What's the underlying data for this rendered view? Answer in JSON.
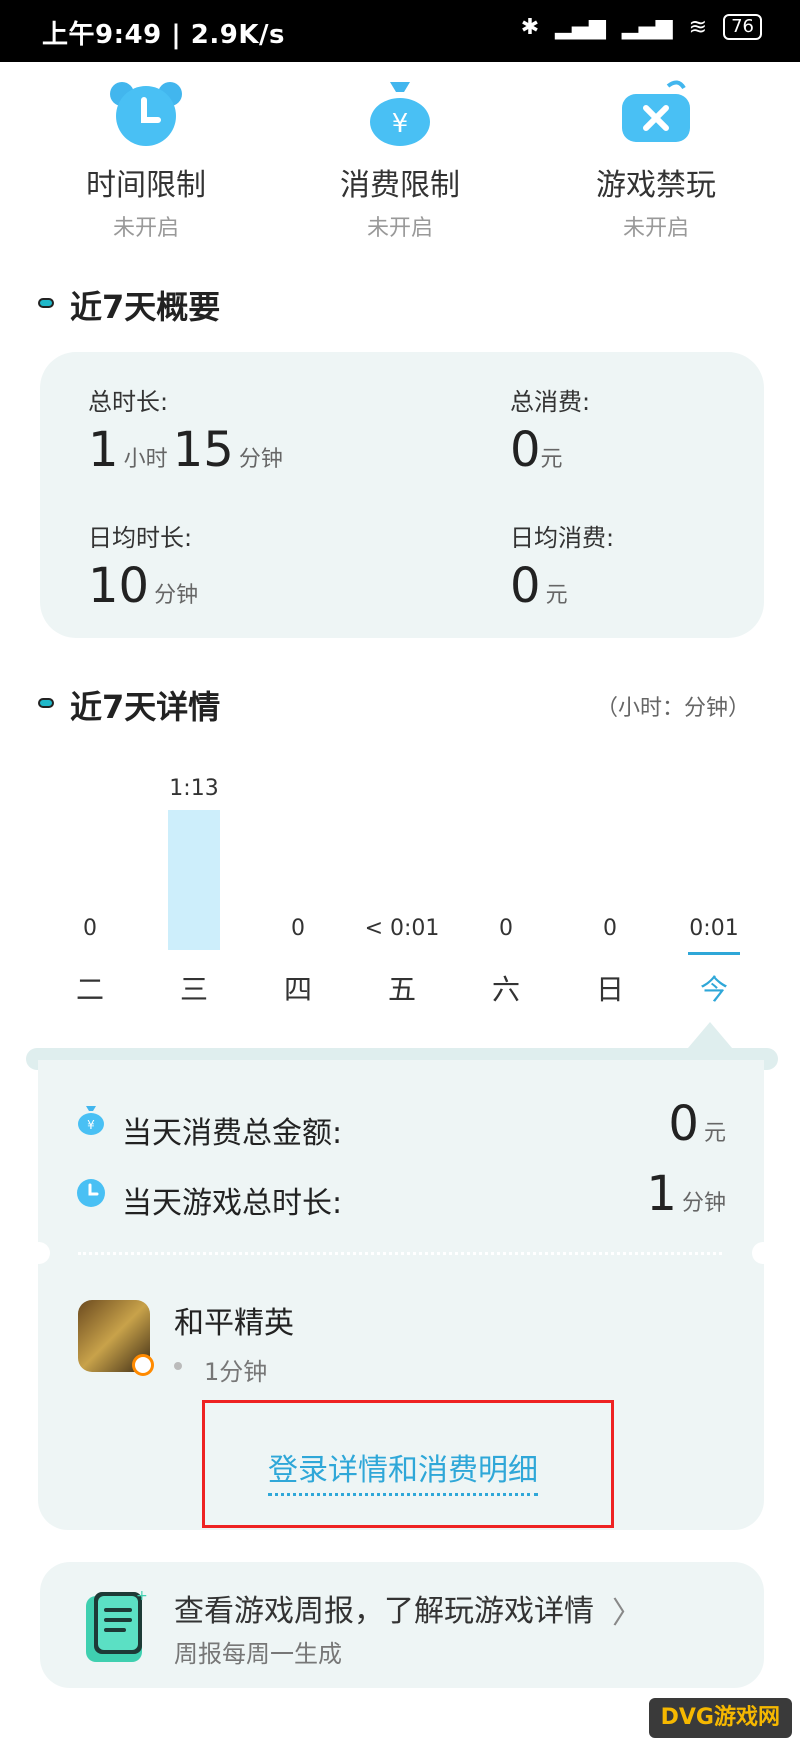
{
  "status_bar": {
    "time": "上午9:49 | 2.9K/s",
    "battery": "76"
  },
  "controls": [
    {
      "label": "时间限制",
      "status": "未开启",
      "icon": "clock-bear-icon"
    },
    {
      "label": "消费限制",
      "status": "未开启",
      "icon": "money-bag-icon"
    },
    {
      "label": "游戏禁玩",
      "status": "未开启",
      "icon": "gamepad-x-icon"
    }
  ],
  "summary": {
    "title": "近7天概要",
    "total_time_label": "总时长:",
    "total_time_h": "1",
    "unit_hour": "小时",
    "total_time_m": "15",
    "unit_min": "分钟",
    "total_spend_label": "总消费:",
    "total_spend": "0",
    "unit_yuan": "元",
    "daily_time_label": "日均时长:",
    "daily_time": "10",
    "daily_spend_label": "日均消费:",
    "daily_spend": "0"
  },
  "details": {
    "title": "近7天详情",
    "unit_note": "（小时：分钟）"
  },
  "chart_data": {
    "type": "bar",
    "categories": [
      "二",
      "三",
      "四",
      "五",
      "六",
      "日",
      "今"
    ],
    "labels": [
      "0",
      "1:13",
      "0",
      "< 0:01",
      "0",
      "0",
      "0:01"
    ],
    "values": [
      0,
      73,
      0,
      0,
      0,
      0,
      1
    ],
    "selected": "今"
  },
  "day_detail": {
    "spend_label": "当天消费总金额:",
    "spend_value": "0",
    "spend_unit": "元",
    "time_label": "当天游戏总时长:",
    "time_value": "1",
    "time_unit": "分钟",
    "game_name": "和平精英",
    "game_time": "1分钟",
    "link": "登录详情和消费明细"
  },
  "weekly": {
    "title": "查看游戏周报，了解玩游戏详情",
    "subtitle": "周报每周一生成"
  },
  "watermark": "DVG游戏网"
}
